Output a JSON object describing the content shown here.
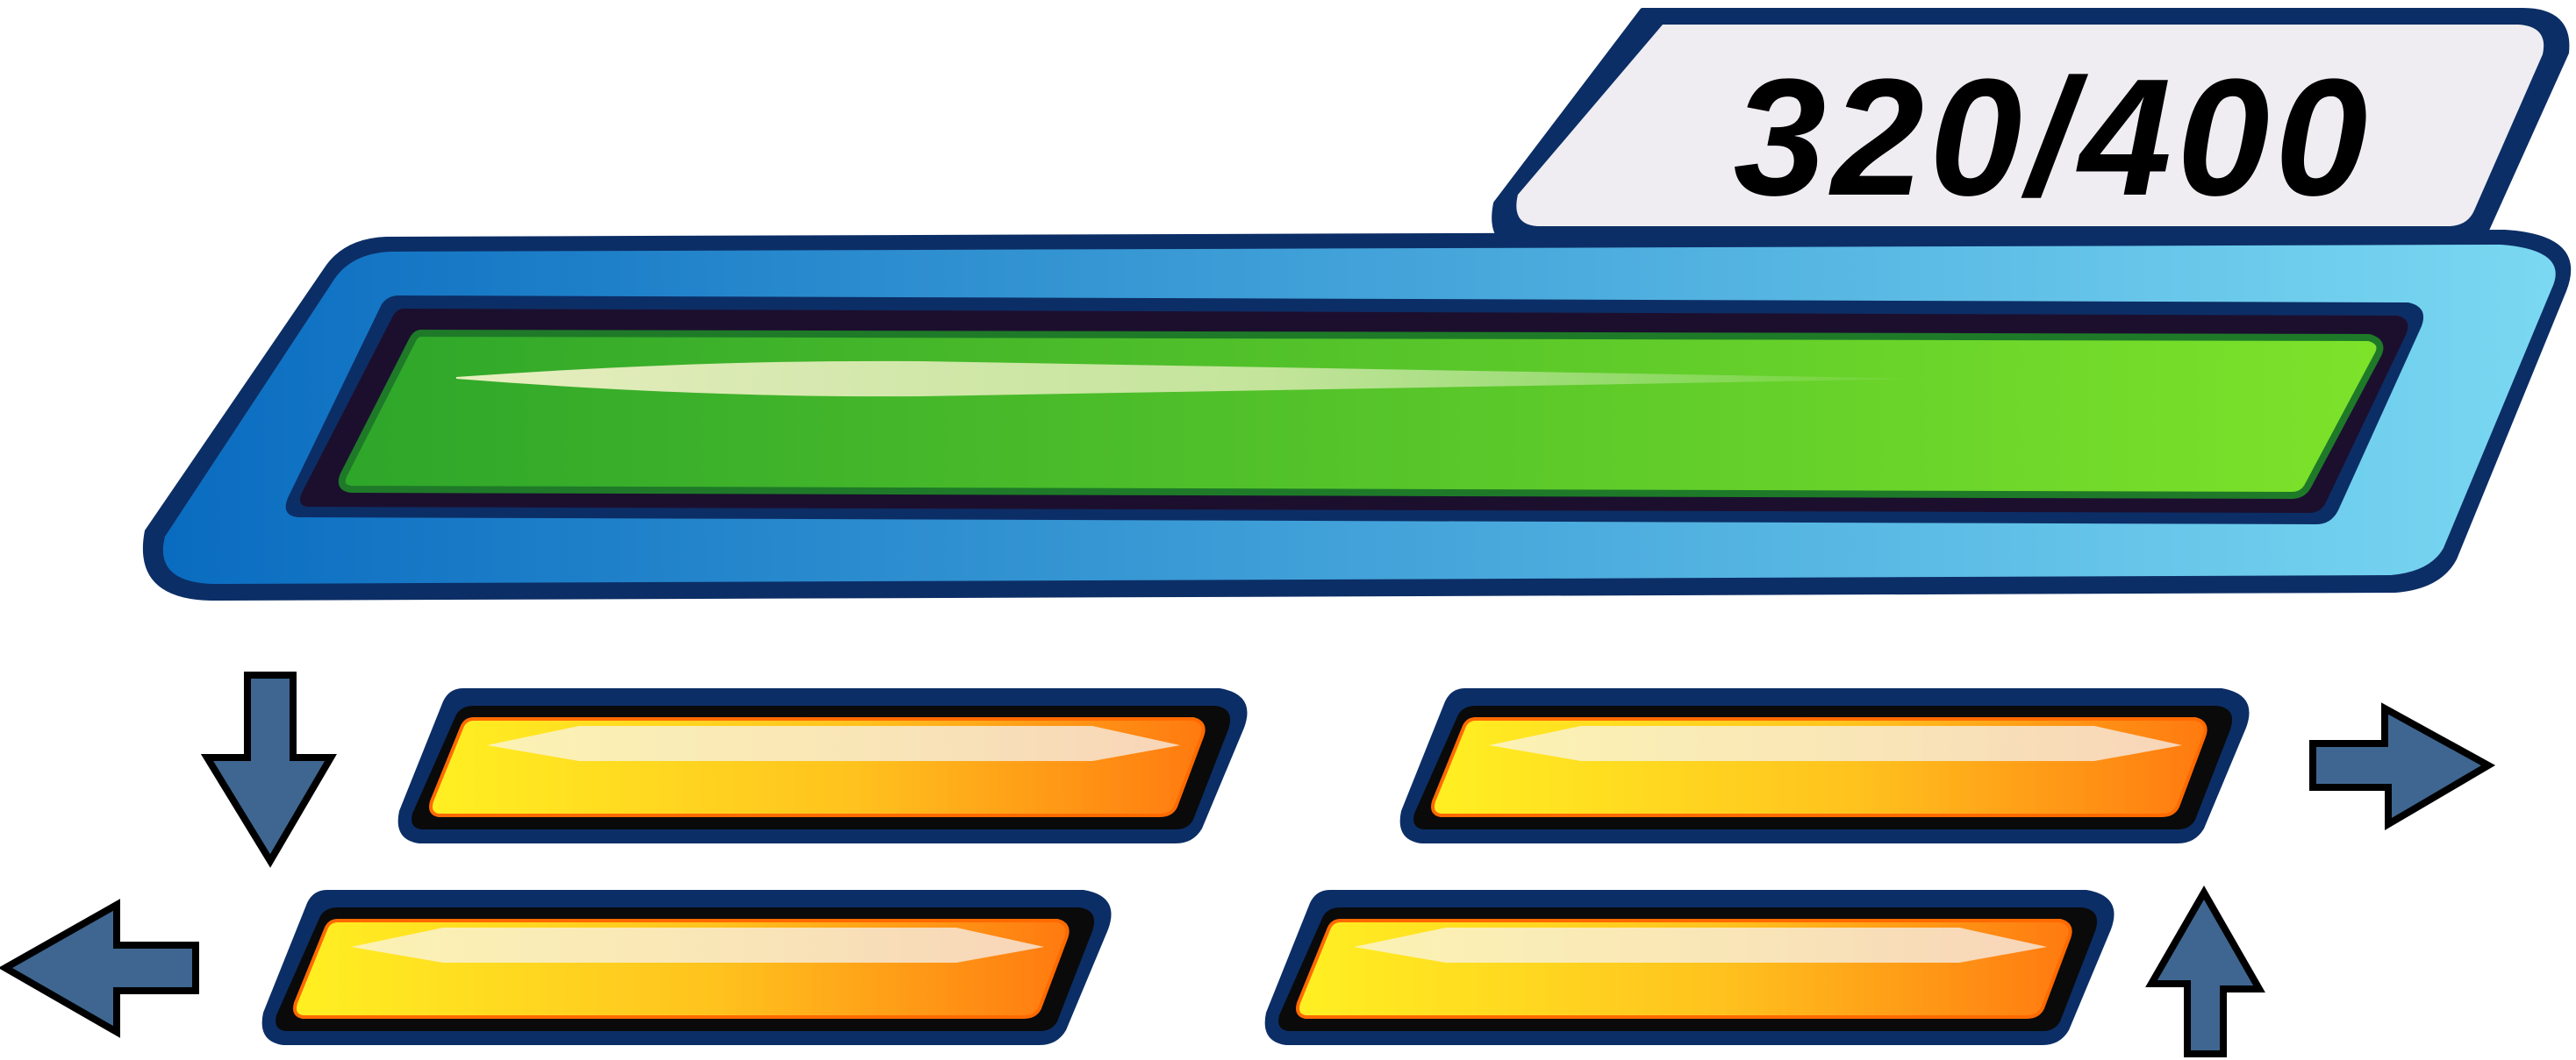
{
  "hud": {
    "counter": {
      "value": 320,
      "max": 400,
      "text": "320/400"
    },
    "main_bar": {
      "fill_fraction": 1.0
    },
    "sub_bars": [
      {
        "id": "top-left",
        "fill_fraction": 1.0
      },
      {
        "id": "top-right",
        "fill_fraction": 1.0
      },
      {
        "id": "bottom-left",
        "fill_fraction": 1.0
      },
      {
        "id": "bottom-right",
        "fill_fraction": 1.0
      }
    ],
    "arrows": [
      {
        "id": "down",
        "icon": "arrow-down-icon"
      },
      {
        "id": "right",
        "icon": "arrow-right-icon"
      },
      {
        "id": "left",
        "icon": "arrow-left-icon"
      },
      {
        "id": "up",
        "icon": "arrow-up-icon"
      }
    ],
    "colors": {
      "outline_navy": "#0c2e66",
      "blue_frame_start": "#0a6cc0",
      "blue_frame_end": "#7ad8f2",
      "green_fill_start": "#2ea62a",
      "green_fill_end": "#7de22a",
      "orange_fill_start": "#fff022",
      "orange_fill_end": "#ff7a10",
      "arrow_fill": "#3e6690",
      "counter_panel": "#efedf2"
    }
  }
}
